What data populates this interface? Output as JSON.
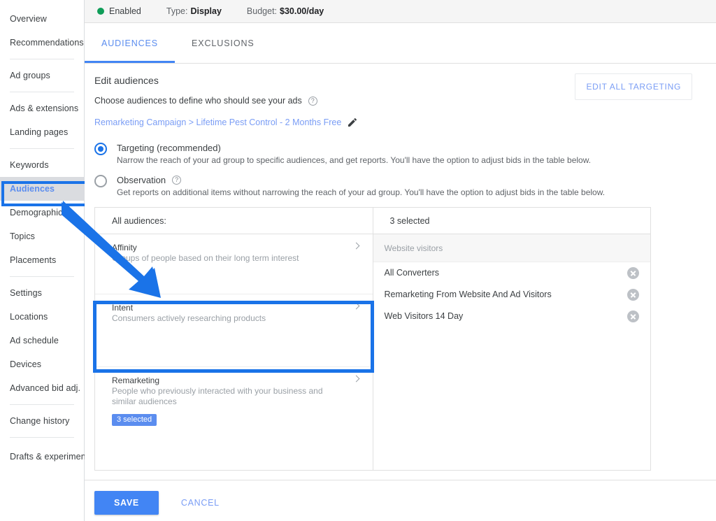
{
  "colors": {
    "accent": "#4285f4",
    "link": "#7a9df5",
    "annotation": "#1a73e8",
    "status_dot": "#0f9d58",
    "badge": "#5b8def"
  },
  "sidebar": {
    "items": [
      {
        "label": "Overview",
        "active": false
      },
      {
        "label": "Recommendations",
        "active": false
      },
      {
        "label": "Ad groups",
        "active": false
      },
      {
        "label": "Ads & extensions",
        "active": false
      },
      {
        "label": "Landing pages",
        "active": false
      },
      {
        "label": "Keywords",
        "active": false
      },
      {
        "label": "Audiences",
        "active": true
      },
      {
        "label": "Demographics",
        "active": false
      },
      {
        "label": "Topics",
        "active": false
      },
      {
        "label": "Placements",
        "active": false
      },
      {
        "label": "Settings",
        "active": false
      },
      {
        "label": "Locations",
        "active": false
      },
      {
        "label": "Ad schedule",
        "active": false
      },
      {
        "label": "Devices",
        "active": false
      },
      {
        "label": "Advanced bid adj.",
        "active": false
      },
      {
        "label": "Change history",
        "active": false
      },
      {
        "label": "Drafts & experiments",
        "active": false
      }
    ]
  },
  "status_strip": {
    "state": "Enabled",
    "type_label": "Type:",
    "type_value": "Display",
    "budget_label": "Budget:",
    "budget_value": "$30.00/day"
  },
  "tabs": [
    {
      "label": "AUDIENCES",
      "active": true
    },
    {
      "label": "EXCLUSIONS",
      "active": false
    }
  ],
  "main": {
    "title": "Edit audiences",
    "subtitle": "Choose audiences to define who should see your ads",
    "help_icon": "help-circle-icon",
    "breadcrumb": "Remarketing Campaign > Lifetime Pest Control - 2 Months Free",
    "edit_icon": "pencil-icon",
    "edit_all_targeting": "EDIT ALL TARGETING"
  },
  "targeting_options": [
    {
      "label": "Targeting (recommended)",
      "description": "Narrow the reach of your ad group to specific audiences, and get reports. You'll have the option to adjust bids in the table below.",
      "selected": true,
      "has_help": false
    },
    {
      "label": "Observation",
      "description": "Get reports on additional items without narrowing the reach of your ad group. You'll have the option to adjust bids in the table below.",
      "selected": false,
      "has_help": true
    }
  ],
  "picker": {
    "left_header": "All audiences:",
    "right_header": "3 selected",
    "categories": [
      {
        "name": "Affinity",
        "description": "Groups of people based on their long term interest",
        "badge": null
      },
      {
        "name": "Intent",
        "description": "Consumers actively researching products",
        "badge": null
      },
      {
        "name": "Remarketing",
        "description": "People who previously interacted with your business and similar audiences",
        "badge": "3 selected"
      }
    ],
    "selected_group": "Website visitors",
    "selected_items": [
      "All Converters",
      "Remarketing From Website And Ad Visitors",
      "Web Visitors 14 Day"
    ]
  },
  "footer": {
    "save_label": "SAVE",
    "cancel_label": "CANCEL"
  },
  "annotations": {
    "arrow": "blue-arrow-annotation",
    "intent_highlight": "intent-highlight-box",
    "audiences_highlight": "audiences-nav-highlight"
  }
}
